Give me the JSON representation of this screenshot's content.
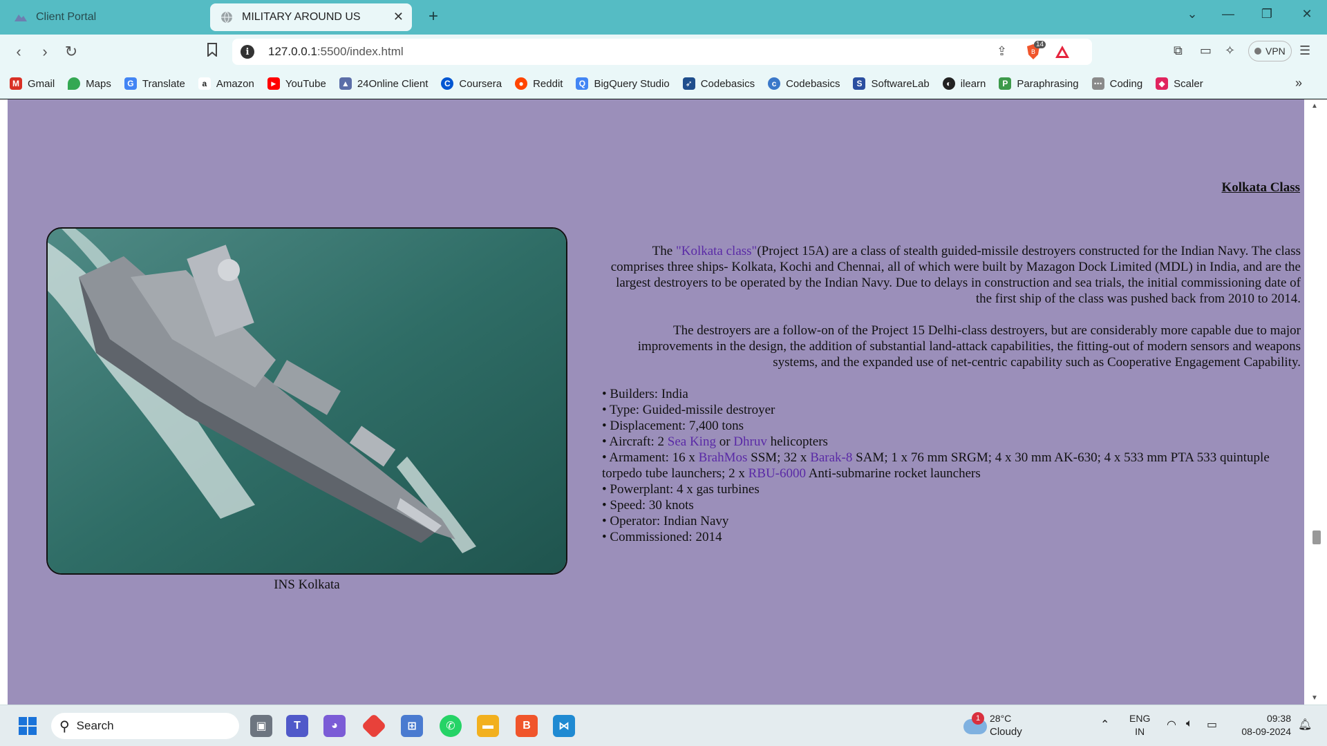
{
  "browser": {
    "tabs": [
      {
        "title": "Client Portal",
        "active": false
      },
      {
        "title": "MILITARY AROUND US",
        "active": true
      }
    ],
    "address": {
      "host": "127.0.0.1",
      "rest": ":5500/index.html"
    },
    "extension_badge": "14",
    "vpn_label": "VPN",
    "bookmarks": [
      {
        "label": "Gmail",
        "icon": "gmail-icon",
        "color": "#d93025"
      },
      {
        "label": "Maps",
        "icon": "maps-icon",
        "color": "#34a853"
      },
      {
        "label": "Translate",
        "icon": "translate-icon",
        "color": "#4285f4"
      },
      {
        "label": "Amazon",
        "icon": "amazon-icon",
        "color": "#222222"
      },
      {
        "label": "YouTube",
        "icon": "youtube-icon",
        "color": "#ff0000"
      },
      {
        "label": "24Online Client",
        "icon": "24online-icon",
        "color": "#5b6ea8"
      },
      {
        "label": "Coursera",
        "icon": "coursera-icon",
        "color": "#0056d2"
      },
      {
        "label": "Reddit",
        "icon": "reddit-icon",
        "color": "#ff4500"
      },
      {
        "label": "BigQuery Studio",
        "icon": "bigquery-icon",
        "color": "#4285f4"
      },
      {
        "label": "Codebasics",
        "icon": "rocket-icon",
        "color": "#1f4e8c"
      },
      {
        "label": "Codebasics",
        "icon": "codebasics-icon",
        "color": "#3a78c9"
      },
      {
        "label": "SoftwareLab",
        "icon": "softwarelab-icon",
        "color": "#2b4fa0"
      },
      {
        "label": "ilearn",
        "icon": "ilearn-icon",
        "color": "#222222"
      },
      {
        "label": "Paraphrasing",
        "icon": "paraphrasing-icon",
        "color": "#3d9a4b"
      },
      {
        "label": "Coding",
        "icon": "coding-icon",
        "color": "#8a8a8a"
      },
      {
        "label": "Scaler",
        "icon": "scaler-icon",
        "color": "#e0245e"
      }
    ]
  },
  "page": {
    "heading": "Kolkata Class",
    "image_caption": "INS Kolkata",
    "para1": {
      "lead": "The ",
      "link": "\"Kolkata class\"",
      "text": "(Project 15A) are a class of stealth guided-missile destroyers constructed for the Indian Navy. The class comprises three ships- Kolkata, Kochi and Chennai, all of which were built by Mazagon Dock Limited (MDL) in India, and are the largest destroyers to be operated by the Indian Navy. Due to delays in construction and sea trials, the initial commissioning date of the first ship of the class was pushed back from 2010 to 2014."
    },
    "para2": "The destroyers are a follow-on of the Project 15 Delhi-class destroyers, but are considerably more capable due to major improvements in the design, the addition of substantial land-attack capabilities, the fitting-out of modern sensors and weapons systems, and the expanded use of net-centric capability such as Cooperative Engagement Capability.",
    "specs": {
      "builders": "• Builders: India",
      "type": "• Type: Guided-missile destroyer",
      "displacement": "• Displacement: 7,400 tons",
      "aircraft_a": "• Aircraft: 2 ",
      "aircraft_link1": "Sea King",
      "aircraft_b": " or ",
      "aircraft_link2": "Dhruv",
      "aircraft_c": " helicopters",
      "arm_a": "• Armament: 16 x ",
      "arm_link1": "BrahMos",
      "arm_b": " SSM; 32 x ",
      "arm_link2": "Barak-8",
      "arm_c": " SAM; 1 x 76 mm SRGM; 4 x 30 mm AK-630; 4 x 533 mm PTA 533 quintuple torpedo tube launchers; 2 x ",
      "arm_link3": "RBU-6000",
      "arm_d": " Anti-submarine rocket launchers",
      "powerplant": "• Powerplant: 4 x gas turbines",
      "speed": "• Speed: 30 knots",
      "operator": "• Operator: Indian Navy",
      "commissioned": "• Commissioned: 2014"
    }
  },
  "taskbar": {
    "search_label": "Search",
    "weather": {
      "badge": "1",
      "temp": "28°C",
      "condition": "Cloudy"
    },
    "lang_top": "ENG",
    "lang_bottom": "IN",
    "time": "09:38",
    "date": "08-09-2024"
  }
}
